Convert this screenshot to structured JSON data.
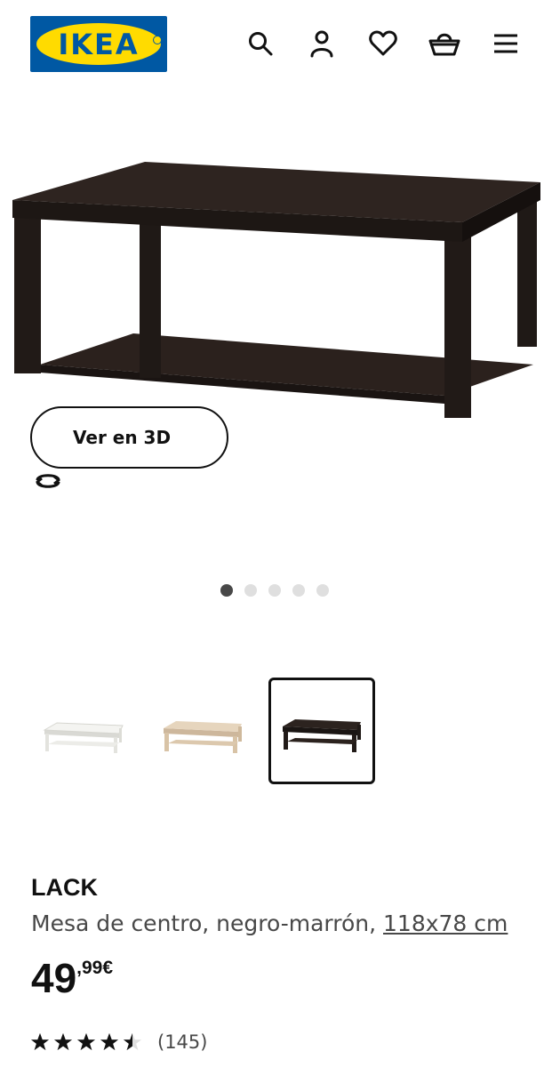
{
  "header": {
    "logo_text": "IKEA",
    "icons": [
      "search-icon",
      "user-icon",
      "heart-icon",
      "basket-icon",
      "menu-icon"
    ]
  },
  "hero": {
    "view_3d_label": "Ver en 3D",
    "carousel": {
      "total": 5,
      "active": 1
    }
  },
  "thumbnails": [
    {
      "color": "white",
      "selected": false
    },
    {
      "color": "white-stained oak",
      "selected": false
    },
    {
      "color": "black-brown",
      "selected": true
    }
  ],
  "product": {
    "name": "LACK",
    "description": "Mesa de centro, negro-marrón,",
    "size": "118x78 cm",
    "price_int": "49",
    "price_dec": ",99€",
    "rating": 4.5,
    "review_count": "(145)"
  },
  "colors": {
    "brand_blue": "#0058a3",
    "brand_yellow": "#ffdb00",
    "text": "#111111",
    "muted": "#484848"
  }
}
